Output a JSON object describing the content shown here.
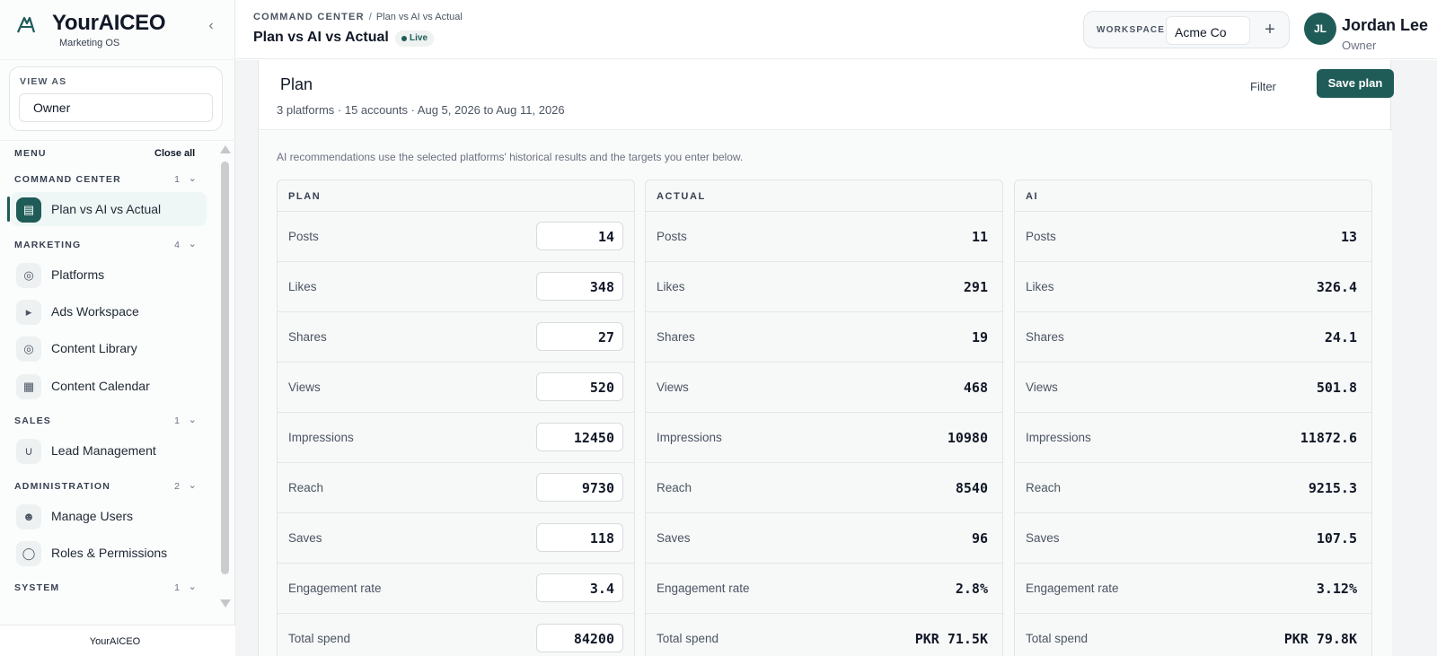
{
  "brand": {
    "name": "YourAICEO",
    "subtitle": "Marketing OS"
  },
  "view_as": {
    "label": "VIEW AS",
    "value": "Owner"
  },
  "menu": {
    "heading": "MENU",
    "close_all": "Close all",
    "sections": [
      {
        "title": "COMMAND CENTER",
        "count": "1",
        "items": [
          "Plan vs AI vs Actual"
        ]
      },
      {
        "title": "MARKETING",
        "count": "4",
        "items": [
          "Platforms",
          "Ads Workspace",
          "Content Library",
          "Content Calendar"
        ]
      },
      {
        "title": "SALES",
        "count": "1",
        "items": [
          "Lead Management"
        ]
      },
      {
        "title": "ADMINISTRATION",
        "count": "2",
        "items": [
          "Manage Users",
          "Roles & Permissions"
        ]
      },
      {
        "title": "SYSTEM",
        "count": "1",
        "items": []
      }
    ]
  },
  "sidebar_footer": "YourAICEO",
  "header": {
    "breadcrumb": {
      "root": "COMMAND CENTER",
      "separator": "/",
      "current": "Plan vs AI vs Actual"
    },
    "title": "Plan vs AI vs Actual",
    "status": "Live",
    "workspace": {
      "label": "WORKSPACE",
      "value": "Acme Co",
      "add": "+"
    },
    "user": {
      "initials": "JL",
      "name": "Jordan Lee",
      "role": "Owner"
    }
  },
  "plan": {
    "title": "Plan",
    "subtitle": "3 platforms · 15 accounts · Aug 5, 2026 to Aug 11, 2026",
    "filter_label": "Filter",
    "save_label": "Save plan",
    "hint": "AI recommendations use the selected platforms' historical results and the targets you enter below.",
    "columns": {
      "plan": "PLAN",
      "actual": "ACTUAL",
      "ai": "AI"
    },
    "metrics": [
      "Posts",
      "Likes",
      "Shares",
      "Views",
      "Impressions",
      "Reach",
      "Saves",
      "Engagement rate",
      "Total spend"
    ],
    "plan_values": [
      "14",
      "348",
      "27",
      "520",
      "12450",
      "9730",
      "118",
      "3.4",
      "84200"
    ],
    "actual_values": [
      "11",
      "291",
      "19",
      "468",
      "10980",
      "8540",
      "96",
      "2.8%",
      "PKR 71.5K"
    ],
    "ai_values": [
      "13",
      "326.4",
      "24.1",
      "501.8",
      "11872.6",
      "9215.3",
      "107.5",
      "3.12%",
      "PKR 79.8K"
    ]
  },
  "colors": {
    "accent": "#1f5c57"
  }
}
